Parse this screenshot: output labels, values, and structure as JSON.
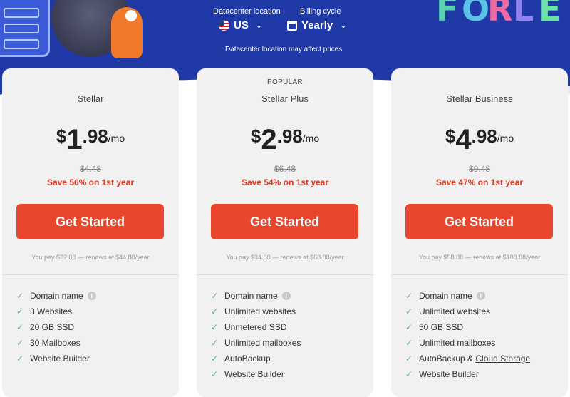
{
  "header": {
    "datacenter_label": "Datacenter location",
    "datacenter_value": "US",
    "billing_label": "Billing cycle",
    "billing_value": "Yearly",
    "note": "Datacenter location may affect prices",
    "decor_text": "FORLE"
  },
  "colors": {
    "hero": "#1f3aa6",
    "button": "#e8472e",
    "save": "#d93a22",
    "check": "#5fa89f"
  },
  "plans": [
    {
      "name": "Stellar",
      "badge": "",
      "currency": "$",
      "price_int": "1",
      "price_dec": ".98",
      "per": "/mo",
      "original": "$4.48",
      "save": "Save 56% on 1st year",
      "button": "Get Started",
      "renew": "You pay $22.88 — renews at $44.88/year",
      "features": [
        "Domain name",
        "3 Websites",
        "20 GB SSD",
        "30 Mailboxes",
        "Website Builder"
      ]
    },
    {
      "name": "Stellar Plus",
      "badge": "POPULAR",
      "currency": "$",
      "price_int": "2",
      "price_dec": ".98",
      "per": "/mo",
      "original": "$6.48",
      "save": "Save 54% on 1st year",
      "button": "Get Started",
      "renew": "You pay $34.88 — renews at $68.88/year",
      "features": [
        "Domain name",
        "Unlimited websites",
        "Unmetered SSD",
        "Unlimited mailboxes",
        "AutoBackup",
        "Website Builder"
      ]
    },
    {
      "name": "Stellar Business",
      "badge": "",
      "currency": "$",
      "price_int": "4",
      "price_dec": ".98",
      "per": "/mo",
      "original": "$9.48",
      "save": "Save 47% on 1st year",
      "button": "Get Started",
      "renew": "You pay $58.88 — renews at $108.88/year",
      "features": [
        "Domain name",
        "Unlimited websites",
        "50 GB SSD",
        "Unlimited mailboxes",
        "AutoBackup & ",
        "Website Builder"
      ],
      "feature_link": "Cloud Storage"
    }
  ],
  "icons": {
    "check": "check-icon",
    "info": "info-icon",
    "flag": "us-flag-icon",
    "calendar": "calendar-icon",
    "chevron": "chevron-down-icon"
  }
}
